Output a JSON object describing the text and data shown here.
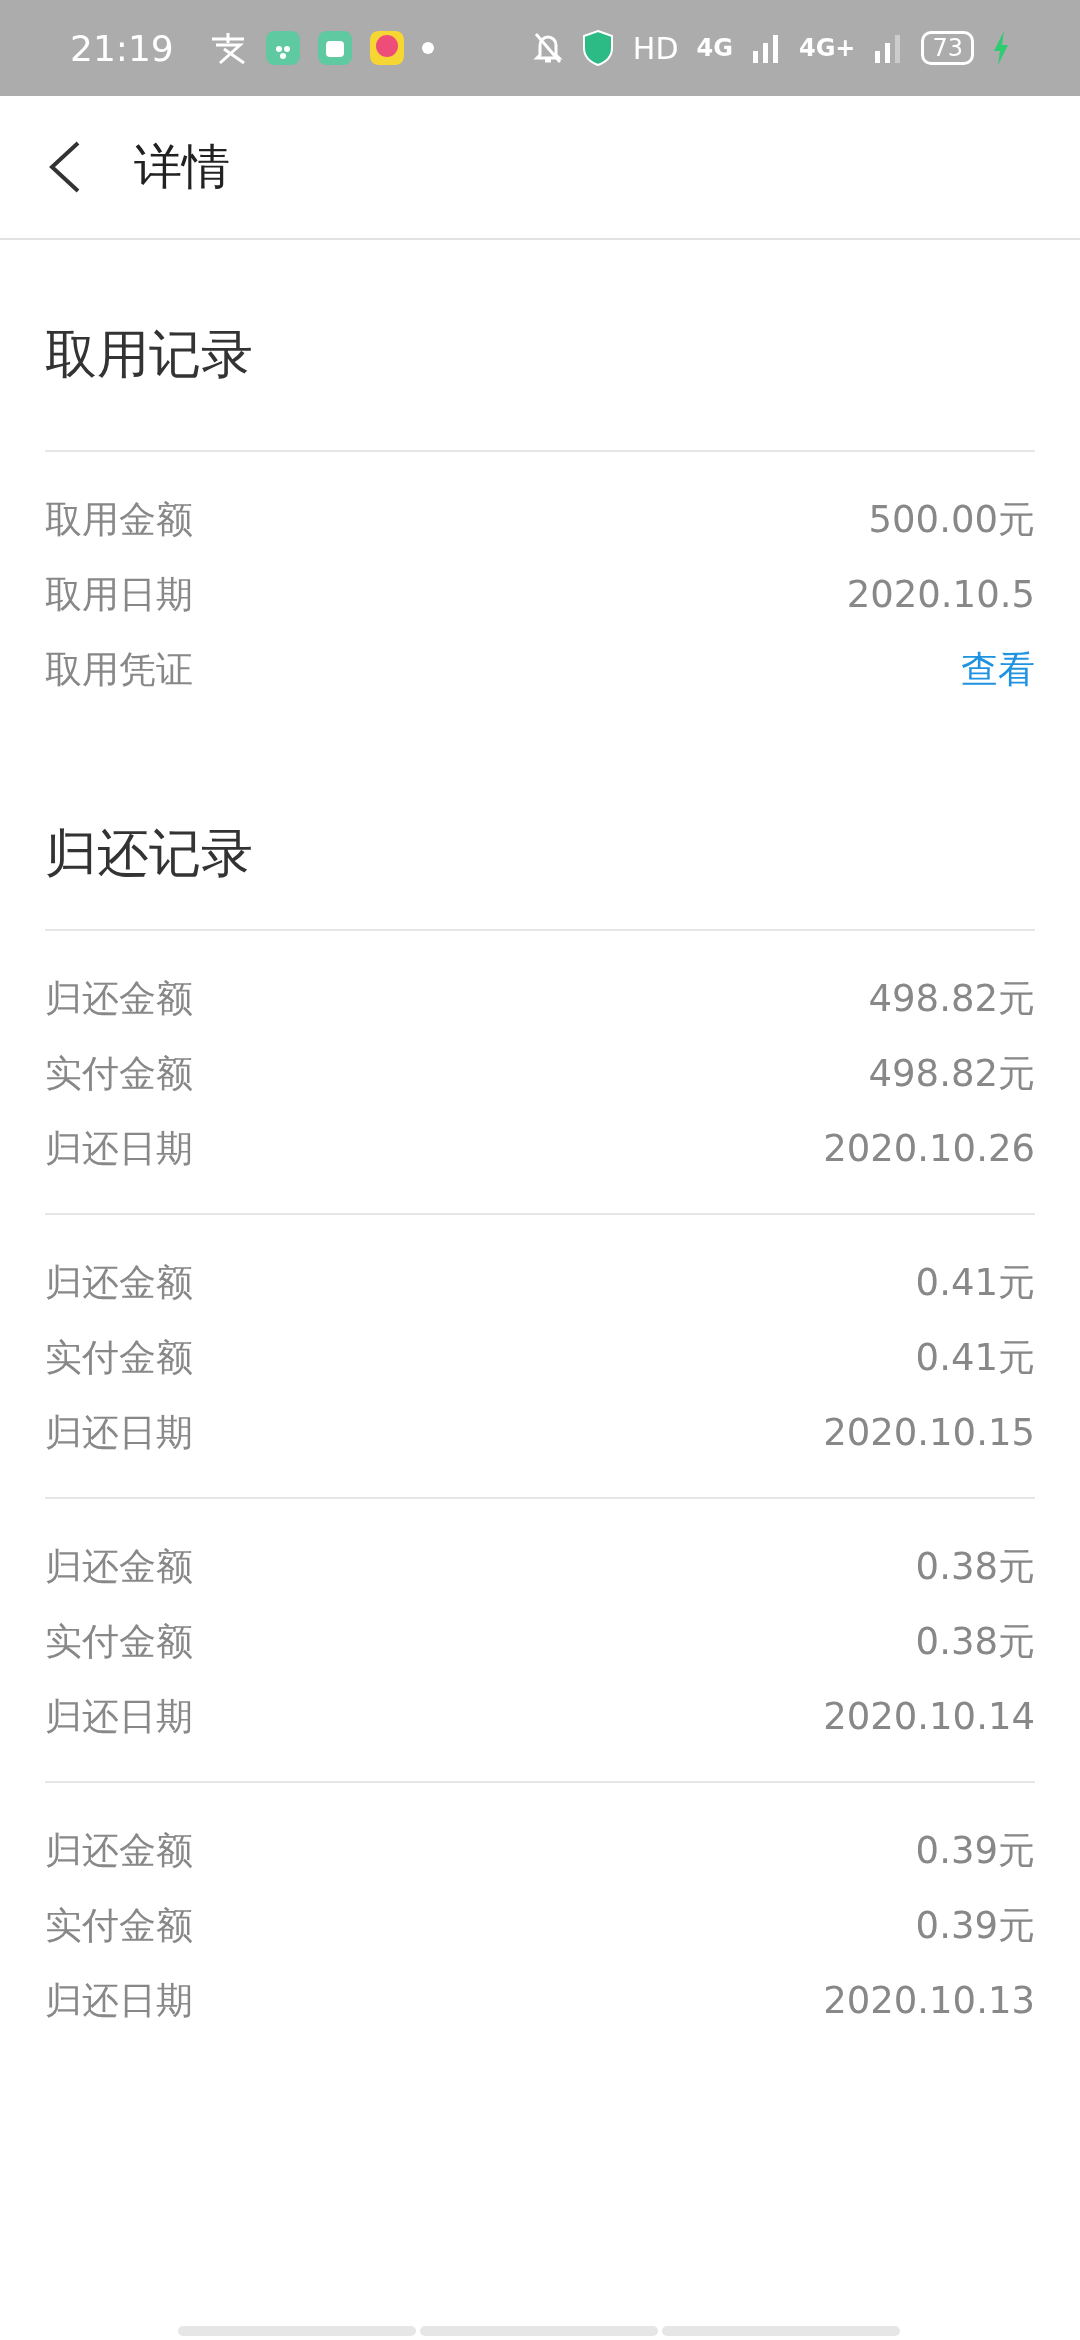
{
  "status_bar": {
    "time": "21:19",
    "hd": "HD",
    "network_1": "4G",
    "network_2": "4G+",
    "battery": "73"
  },
  "header": {
    "title": "详情"
  },
  "withdrawal": {
    "title": "取用记录",
    "rows": [
      {
        "label": "取用金额",
        "value": "500.00元",
        "kind": "text"
      },
      {
        "label": "取用日期",
        "value": "2020.10.5",
        "kind": "text"
      },
      {
        "label": "取用凭证",
        "value": "查看",
        "kind": "link"
      }
    ]
  },
  "repayment": {
    "title": "归还记录",
    "groups": [
      [
        {
          "label": "归还金额",
          "value": "498.82元"
        },
        {
          "label": "实付金额",
          "value": "498.82元"
        },
        {
          "label": "归还日期",
          "value": "2020.10.26"
        }
      ],
      [
        {
          "label": "归还金额",
          "value": "0.41元"
        },
        {
          "label": "实付金额",
          "value": "0.41元"
        },
        {
          "label": "归还日期",
          "value": "2020.10.15"
        }
      ],
      [
        {
          "label": "归还金额",
          "value": "0.38元"
        },
        {
          "label": "实付金额",
          "value": "0.38元"
        },
        {
          "label": "归还日期",
          "value": "2020.10.14"
        }
      ],
      [
        {
          "label": "归还金额",
          "value": "0.39元"
        },
        {
          "label": "实付金额",
          "value": "0.39元"
        },
        {
          "label": "归还日期",
          "value": "2020.10.13"
        }
      ]
    ]
  }
}
